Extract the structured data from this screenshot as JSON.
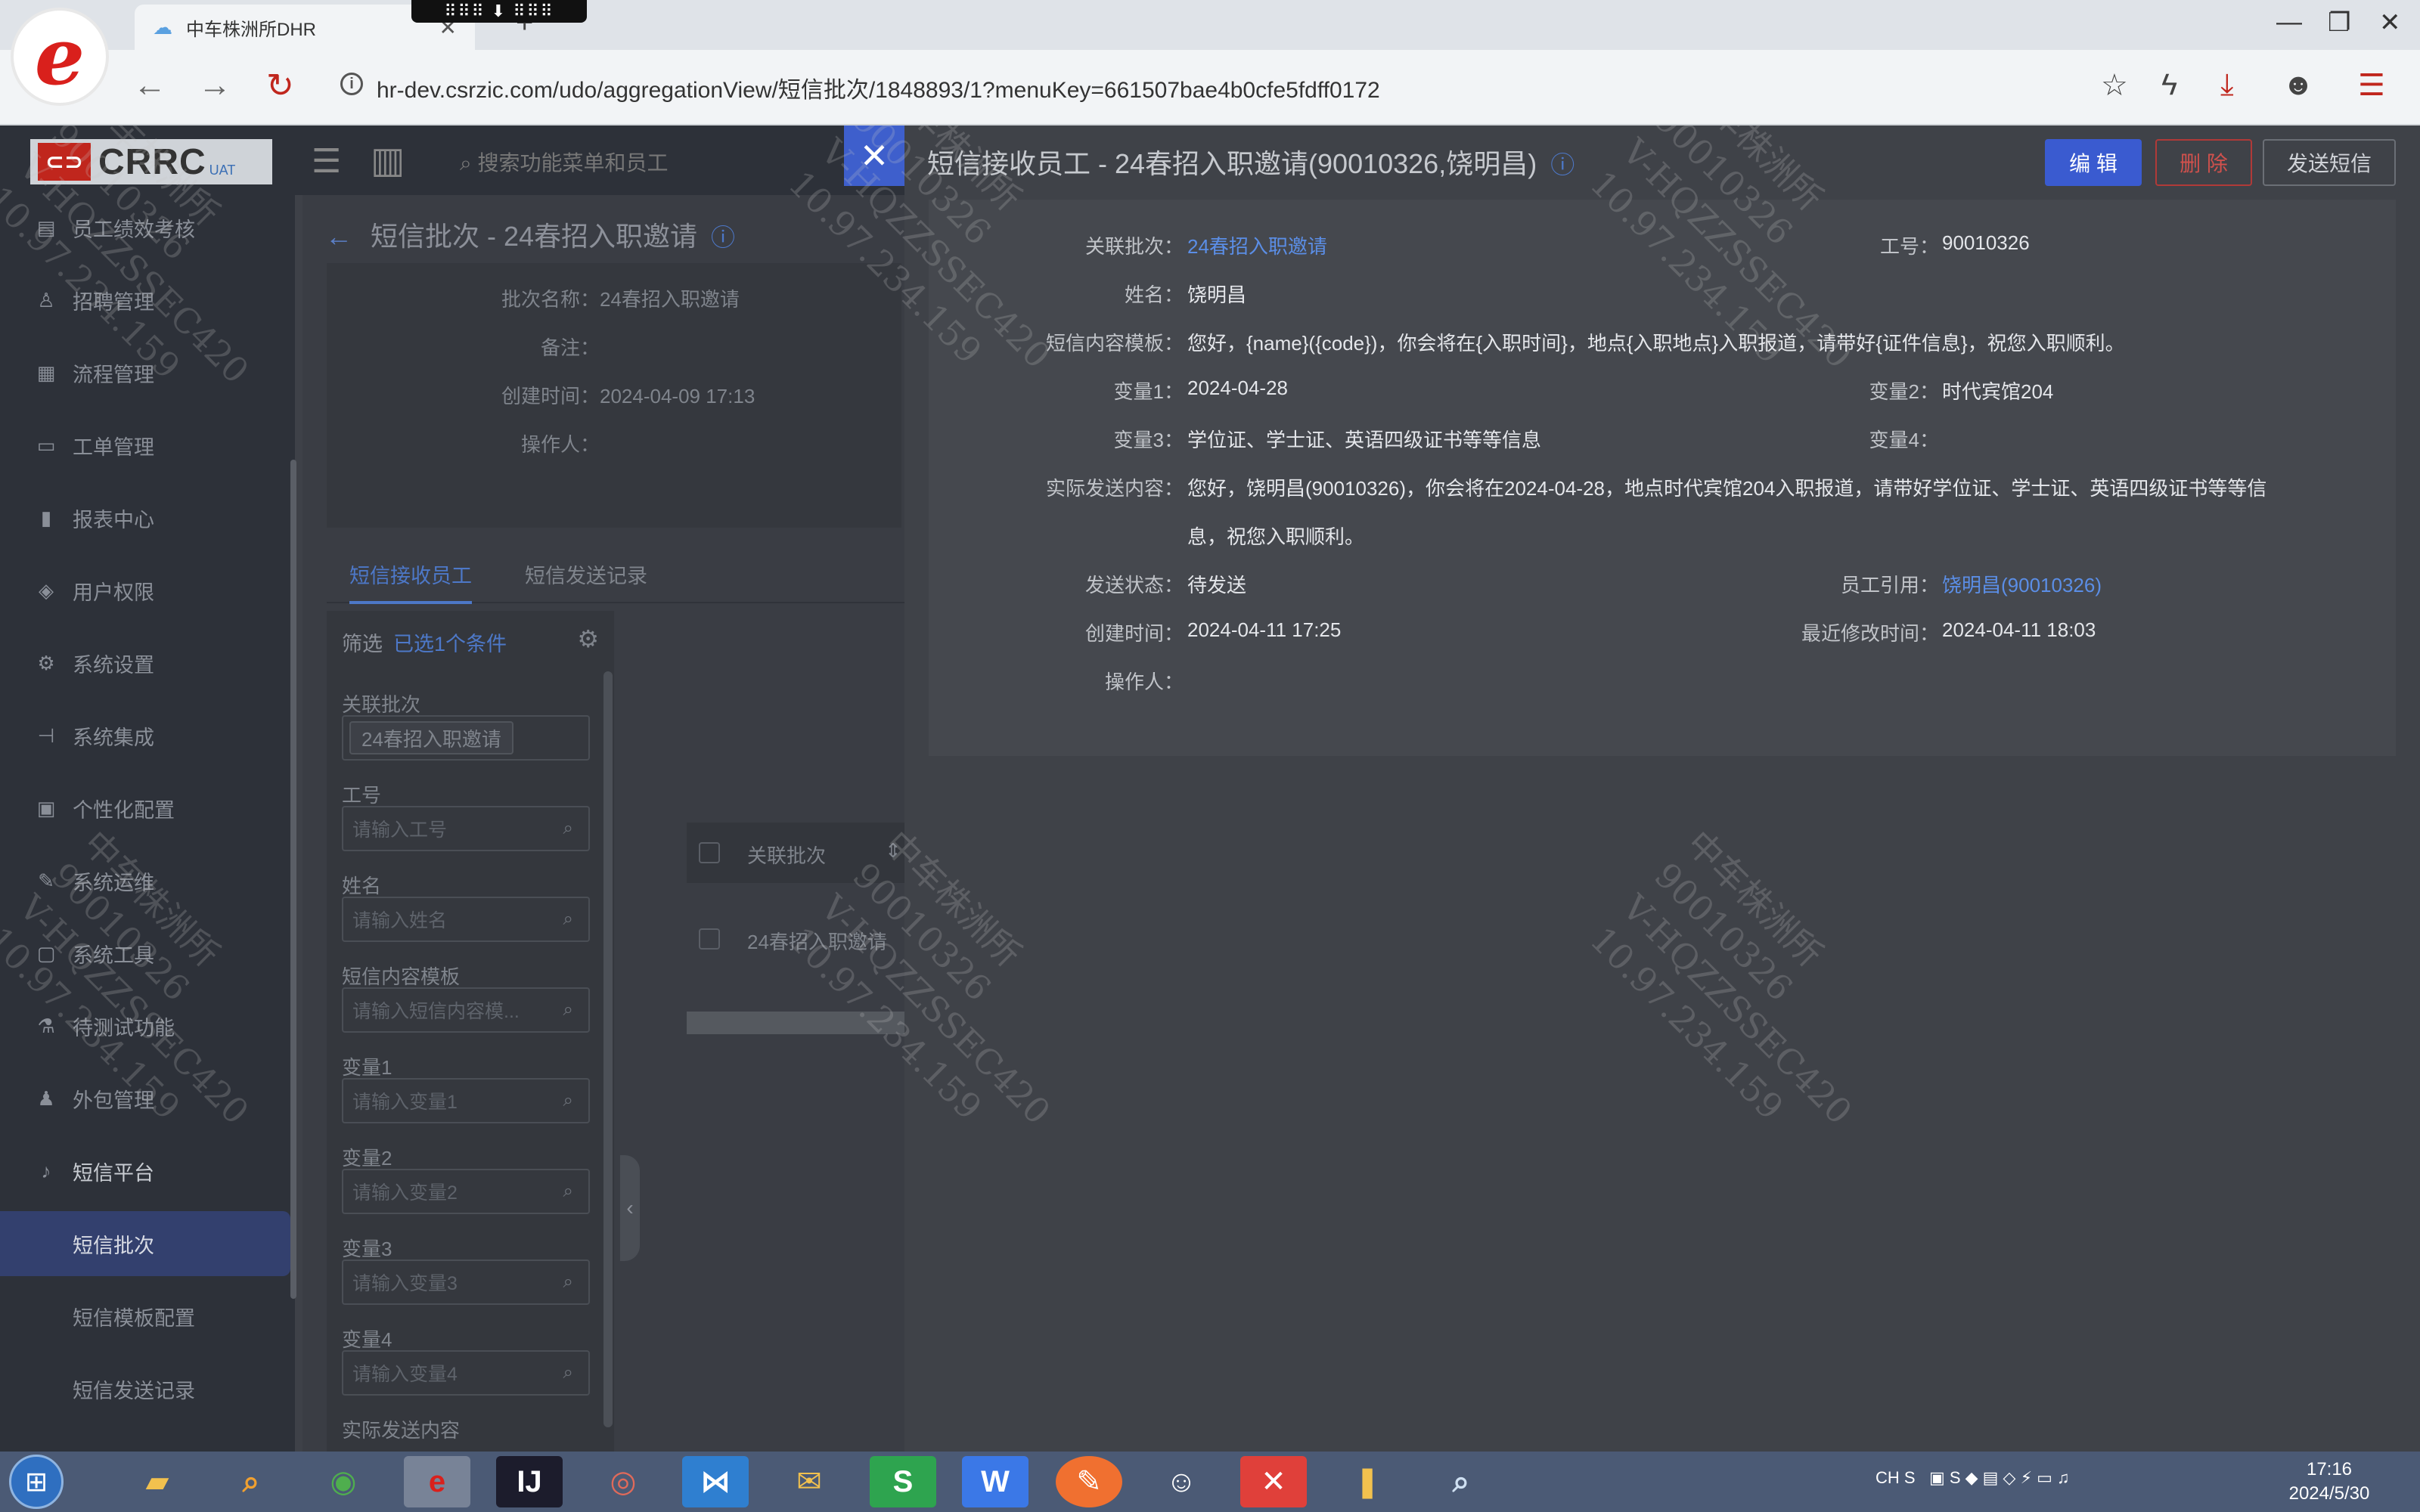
{
  "browser": {
    "tab_title": "中车株洲所DHR",
    "url": "hr-dev.csrzic.com/udo/aggregationView/短信批次/1848893/1?menuKey=661507bae4b0cfe5fdff0172",
    "logo_letter": "e"
  },
  "app": {
    "brand": "CRRC",
    "brand_tag": "UAT",
    "search_placeholder": "搜索功能菜单和员工"
  },
  "sidebar": {
    "items": [
      {
        "label": "员工绩效考核",
        "icon": "doc-icon"
      },
      {
        "label": "招聘管理",
        "icon": "user-icon"
      },
      {
        "label": "流程管理",
        "icon": "flow-icon"
      },
      {
        "label": "工单管理",
        "icon": "ticket-icon"
      },
      {
        "label": "报表中心",
        "icon": "chart-icon"
      },
      {
        "label": "用户权限",
        "icon": "shield-icon"
      },
      {
        "label": "系统设置",
        "icon": "gear-icon"
      },
      {
        "label": "系统集成",
        "icon": "plug-icon"
      },
      {
        "label": "个性化配置",
        "icon": "grid-icon"
      },
      {
        "label": "系统运维",
        "icon": "tool-icon"
      },
      {
        "label": "系统工具",
        "icon": "box-icon"
      },
      {
        "label": "待测试功能",
        "icon": "flask-icon"
      },
      {
        "label": "外包管理",
        "icon": "people-icon"
      },
      {
        "label": "短信平台",
        "icon": "bell-icon"
      }
    ],
    "sub_items": [
      "短信批次",
      "短信模板配置",
      "短信发送记录"
    ]
  },
  "batch_page": {
    "title": "短信批次 - 24春招入职邀请",
    "fields": [
      {
        "label": "批次名称：",
        "value": "24春招入职邀请"
      },
      {
        "label": "备注：",
        "value": ""
      },
      {
        "label": "创建时间：",
        "value": "2024-04-09 17:13"
      },
      {
        "label": "操作人：",
        "value": ""
      }
    ],
    "tabs": [
      "短信接收员工",
      "短信发送记录"
    ],
    "filter": {
      "title": "筛选",
      "selected": "已选1个条件",
      "fields": [
        {
          "label": "关联批次",
          "value": "24春招入职邀请"
        },
        {
          "label": "工号",
          "placeholder": "请输入工号"
        },
        {
          "label": "姓名",
          "placeholder": "请输入姓名"
        },
        {
          "label": "短信内容模板",
          "placeholder": "请输入短信内容模..."
        },
        {
          "label": "变量1",
          "placeholder": "请输入变量1"
        },
        {
          "label": "变量2",
          "placeholder": "请输入变量2"
        },
        {
          "label": "变量3",
          "placeholder": "请输入变量3"
        },
        {
          "label": "变量4",
          "placeholder": "请输入变量4"
        },
        {
          "label": "实际发送内容"
        }
      ]
    },
    "table": {
      "column": "关联批次",
      "rows": [
        "24春招入职邀请"
      ]
    }
  },
  "drawer": {
    "title": "短信接收员工 - 24春招入职邀请(90010326,饶明昌)",
    "buttons": {
      "edit": "编 辑",
      "delete": "删 除",
      "send": "发送短信"
    },
    "fields": {
      "batch_label": "关联批次：",
      "batch_value": "24春招入职邀请",
      "empno_label": "工号：",
      "empno_value": "90010326",
      "name_label": "姓名：",
      "name_value": "饶明昌",
      "template_label": "短信内容模板：",
      "template_value": "您好，{name}({code})，你会将在{入职时间}，地点{入职地点}入职报道，请带好{证件信息}，祝您入职顺利。",
      "var1_label": "变量1：",
      "var1_value": "2024-04-28",
      "var2_label": "变量2：",
      "var2_value": "时代宾馆204",
      "var3_label": "变量3：",
      "var3_value": "学位证、学士证、英语四级证书等等信息",
      "var4_label": "变量4：",
      "var4_value": "",
      "content_label": "实际发送内容：",
      "content_line1": "您好，饶明昌(90010326)，你会将在2024-04-28，地点时代宾馆204入职报道，请带好学位证、学士证、英语四级证书等等信",
      "content_line2": "息，祝您入职顺利。",
      "status_label": "发送状态：",
      "status_value": "待发送",
      "ref_label": "员工引用：",
      "ref_value": "饶明昌(90010326)",
      "created_label": "创建时间：",
      "created_value": "2024-04-11 17:25",
      "modified_label": "最近修改时间：",
      "modified_value": "2024-04-11 18:03",
      "operator_label": "操作人：",
      "operator_value": ""
    }
  },
  "watermark": {
    "line1": "中车株洲所",
    "line2": "90010326",
    "line3": "V-HQZZSSEC420",
    "line4": "10.97.234.159"
  },
  "taskbar": {
    "tray_lang": "CH",
    "time": "17:16",
    "date": "2024/5/30"
  },
  "colors": {
    "accent": "#3a5bd0",
    "danger": "#d0514d",
    "link": "#5b8ee6"
  }
}
